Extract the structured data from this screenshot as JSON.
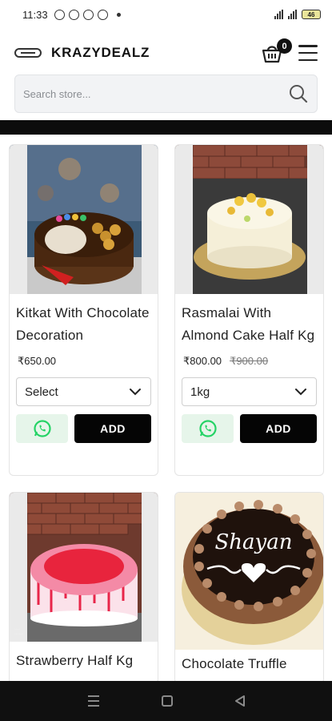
{
  "status_bar": {
    "time": "11:33",
    "battery": "46"
  },
  "header": {
    "brand": "KRAZYDEALZ",
    "cart_count": "0"
  },
  "search": {
    "placeholder": "Search store..."
  },
  "products": [
    {
      "title": "Kitkat With Chocolate Decoration",
      "price": "₹650.00",
      "old_price": "",
      "variant": "Select",
      "add_label": "ADD"
    },
    {
      "title": "Rasmalai With Almond Cake Half Kg",
      "price": "₹800.00",
      "old_price": "₹900.00",
      "variant": "1kg",
      "add_label": "ADD"
    },
    {
      "title": "Strawberry Half Kg"
    },
    {
      "title": "Chocolate Truffle"
    }
  ],
  "colors": {
    "accent": "#050505",
    "whatsapp": "#25d366",
    "whatsapp_bg": "#e6f5ea"
  },
  "icons": [
    "cart-icon",
    "menu-icon",
    "search-icon",
    "whatsapp-icon",
    "chevron-down-icon"
  ]
}
